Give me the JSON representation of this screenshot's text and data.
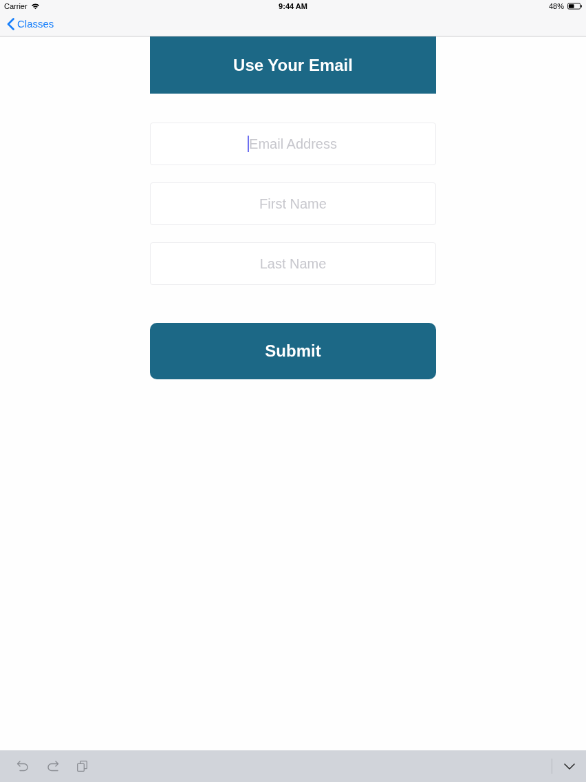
{
  "status_bar": {
    "carrier": "Carrier",
    "time": "9:44 AM",
    "battery": "48%"
  },
  "nav_bar": {
    "back_label": "Classes"
  },
  "header": {
    "title": "Use Your Email"
  },
  "form": {
    "fields": [
      {
        "placeholder": "Email Address",
        "focused": true
      },
      {
        "placeholder": "First Name",
        "focused": false
      },
      {
        "placeholder": "Last Name",
        "focused": false
      }
    ],
    "submit": "Submit"
  }
}
